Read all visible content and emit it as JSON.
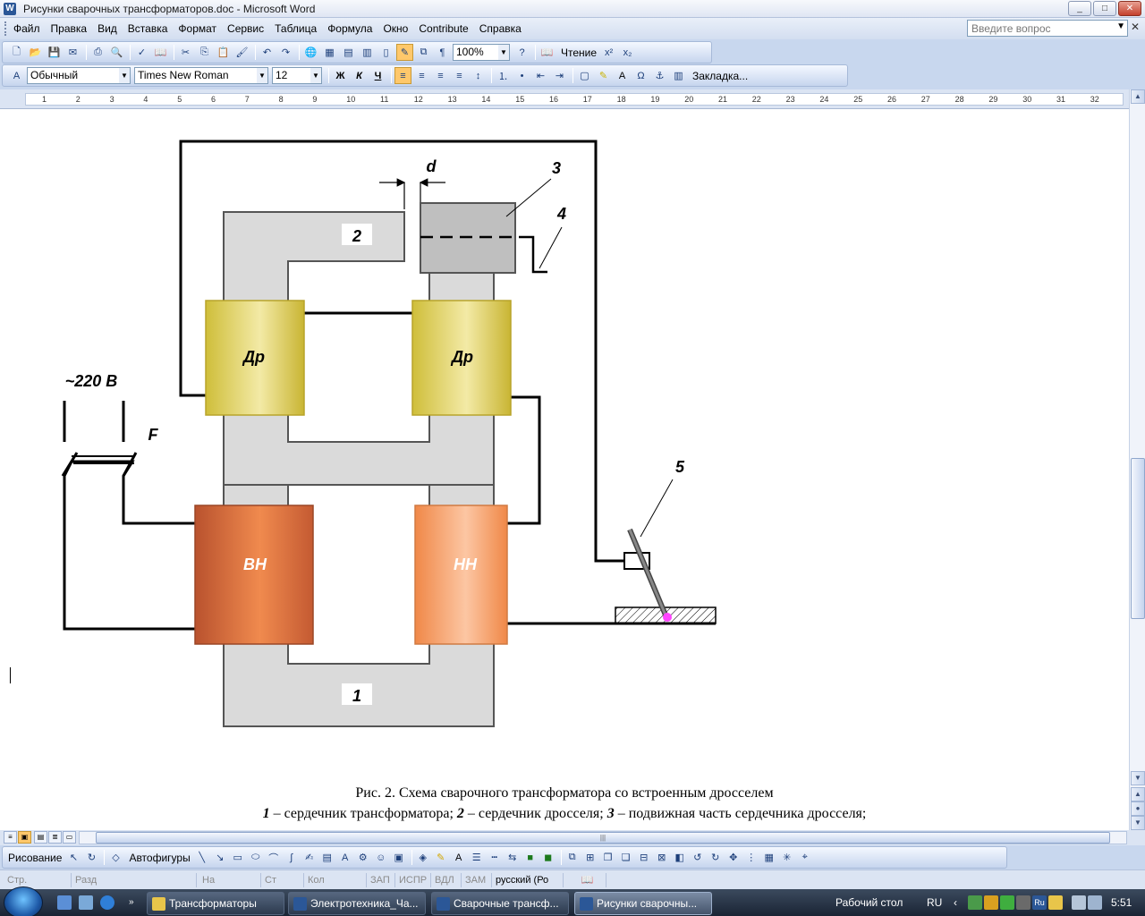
{
  "window": {
    "title": "Рисунки сварочных трансформаторов.doc - Microsoft Word",
    "app_icon": "W",
    "controls": {
      "minimize": "_",
      "maximize": "□",
      "close": "✕"
    }
  },
  "menu": {
    "items": [
      "Файл",
      "Правка",
      "Вид",
      "Вставка",
      "Формат",
      "Сервис",
      "Таблица",
      "Формула",
      "Окно",
      "Contribute",
      "Справка"
    ],
    "help_placeholder": "Введите вопрос"
  },
  "toolbar_standard": {
    "zoom": "100%",
    "reading_label": "Чтение"
  },
  "toolbar_format": {
    "style": "Обычный",
    "font": "Times New Roman",
    "size": "12",
    "bold": "Ж",
    "italic": "К",
    "underline": "Ч",
    "bookmark_label": "Закладка..."
  },
  "ruler": {
    "marks": [
      "1",
      "2",
      "3",
      "4",
      "5",
      "6",
      "7",
      "8",
      "9",
      "10",
      "11",
      "12",
      "13",
      "14",
      "15",
      "16",
      "17",
      "18",
      "19",
      "20",
      "21",
      "22",
      "23",
      "24",
      "25",
      "26",
      "27",
      "28",
      "29",
      "30",
      "31",
      "32"
    ]
  },
  "diagram": {
    "label_d": "d",
    "label_3": "3",
    "label_4": "4",
    "label_5": "5",
    "label_2": "2",
    "label_1": "1",
    "label_voltage": "~220 В",
    "label_f": "F",
    "coil_dr_left": "Др",
    "coil_dr_right": "Др",
    "coil_vn": "ВН",
    "coil_nn": "НН",
    "colors": {
      "core": "#dadada",
      "choke": "#e4d24a",
      "vn": "#d4663a",
      "nn": "#f59a63",
      "movable": "#bfbfbf",
      "spark": "#ff44ff"
    }
  },
  "caption": {
    "title": "Рис. 2. Схема сварочного трансформатора со встроенным дросселем",
    "n1": "1",
    "t1": " – сердечник трансформатора; ",
    "n2": "2",
    "t2": " – сердечник дросселя; ",
    "n3": "3",
    "t3": " – подвижная часть сердечника дросселя;"
  },
  "drawing_toolbar": {
    "draw_label": "Рисование",
    "autoshapes_label": "Автофигуры"
  },
  "statusbar": {
    "page": "Стр.",
    "section": "Разд",
    "at": "На",
    "line": "Ст",
    "col": "Кол",
    "rec": "ЗАП",
    "trk": "ИСПР",
    "ext": "ВДЛ",
    "ovr": "ЗАМ",
    "language": "русский (Ро"
  },
  "taskbar": {
    "tasks": [
      "Трансформаторы",
      "Электротехника_Ча...",
      "Сварочные трансф...",
      "Рисунки сварочны..."
    ],
    "desktop_label": "Рабочий стол",
    "lang": "RU",
    "time": "5:51"
  }
}
